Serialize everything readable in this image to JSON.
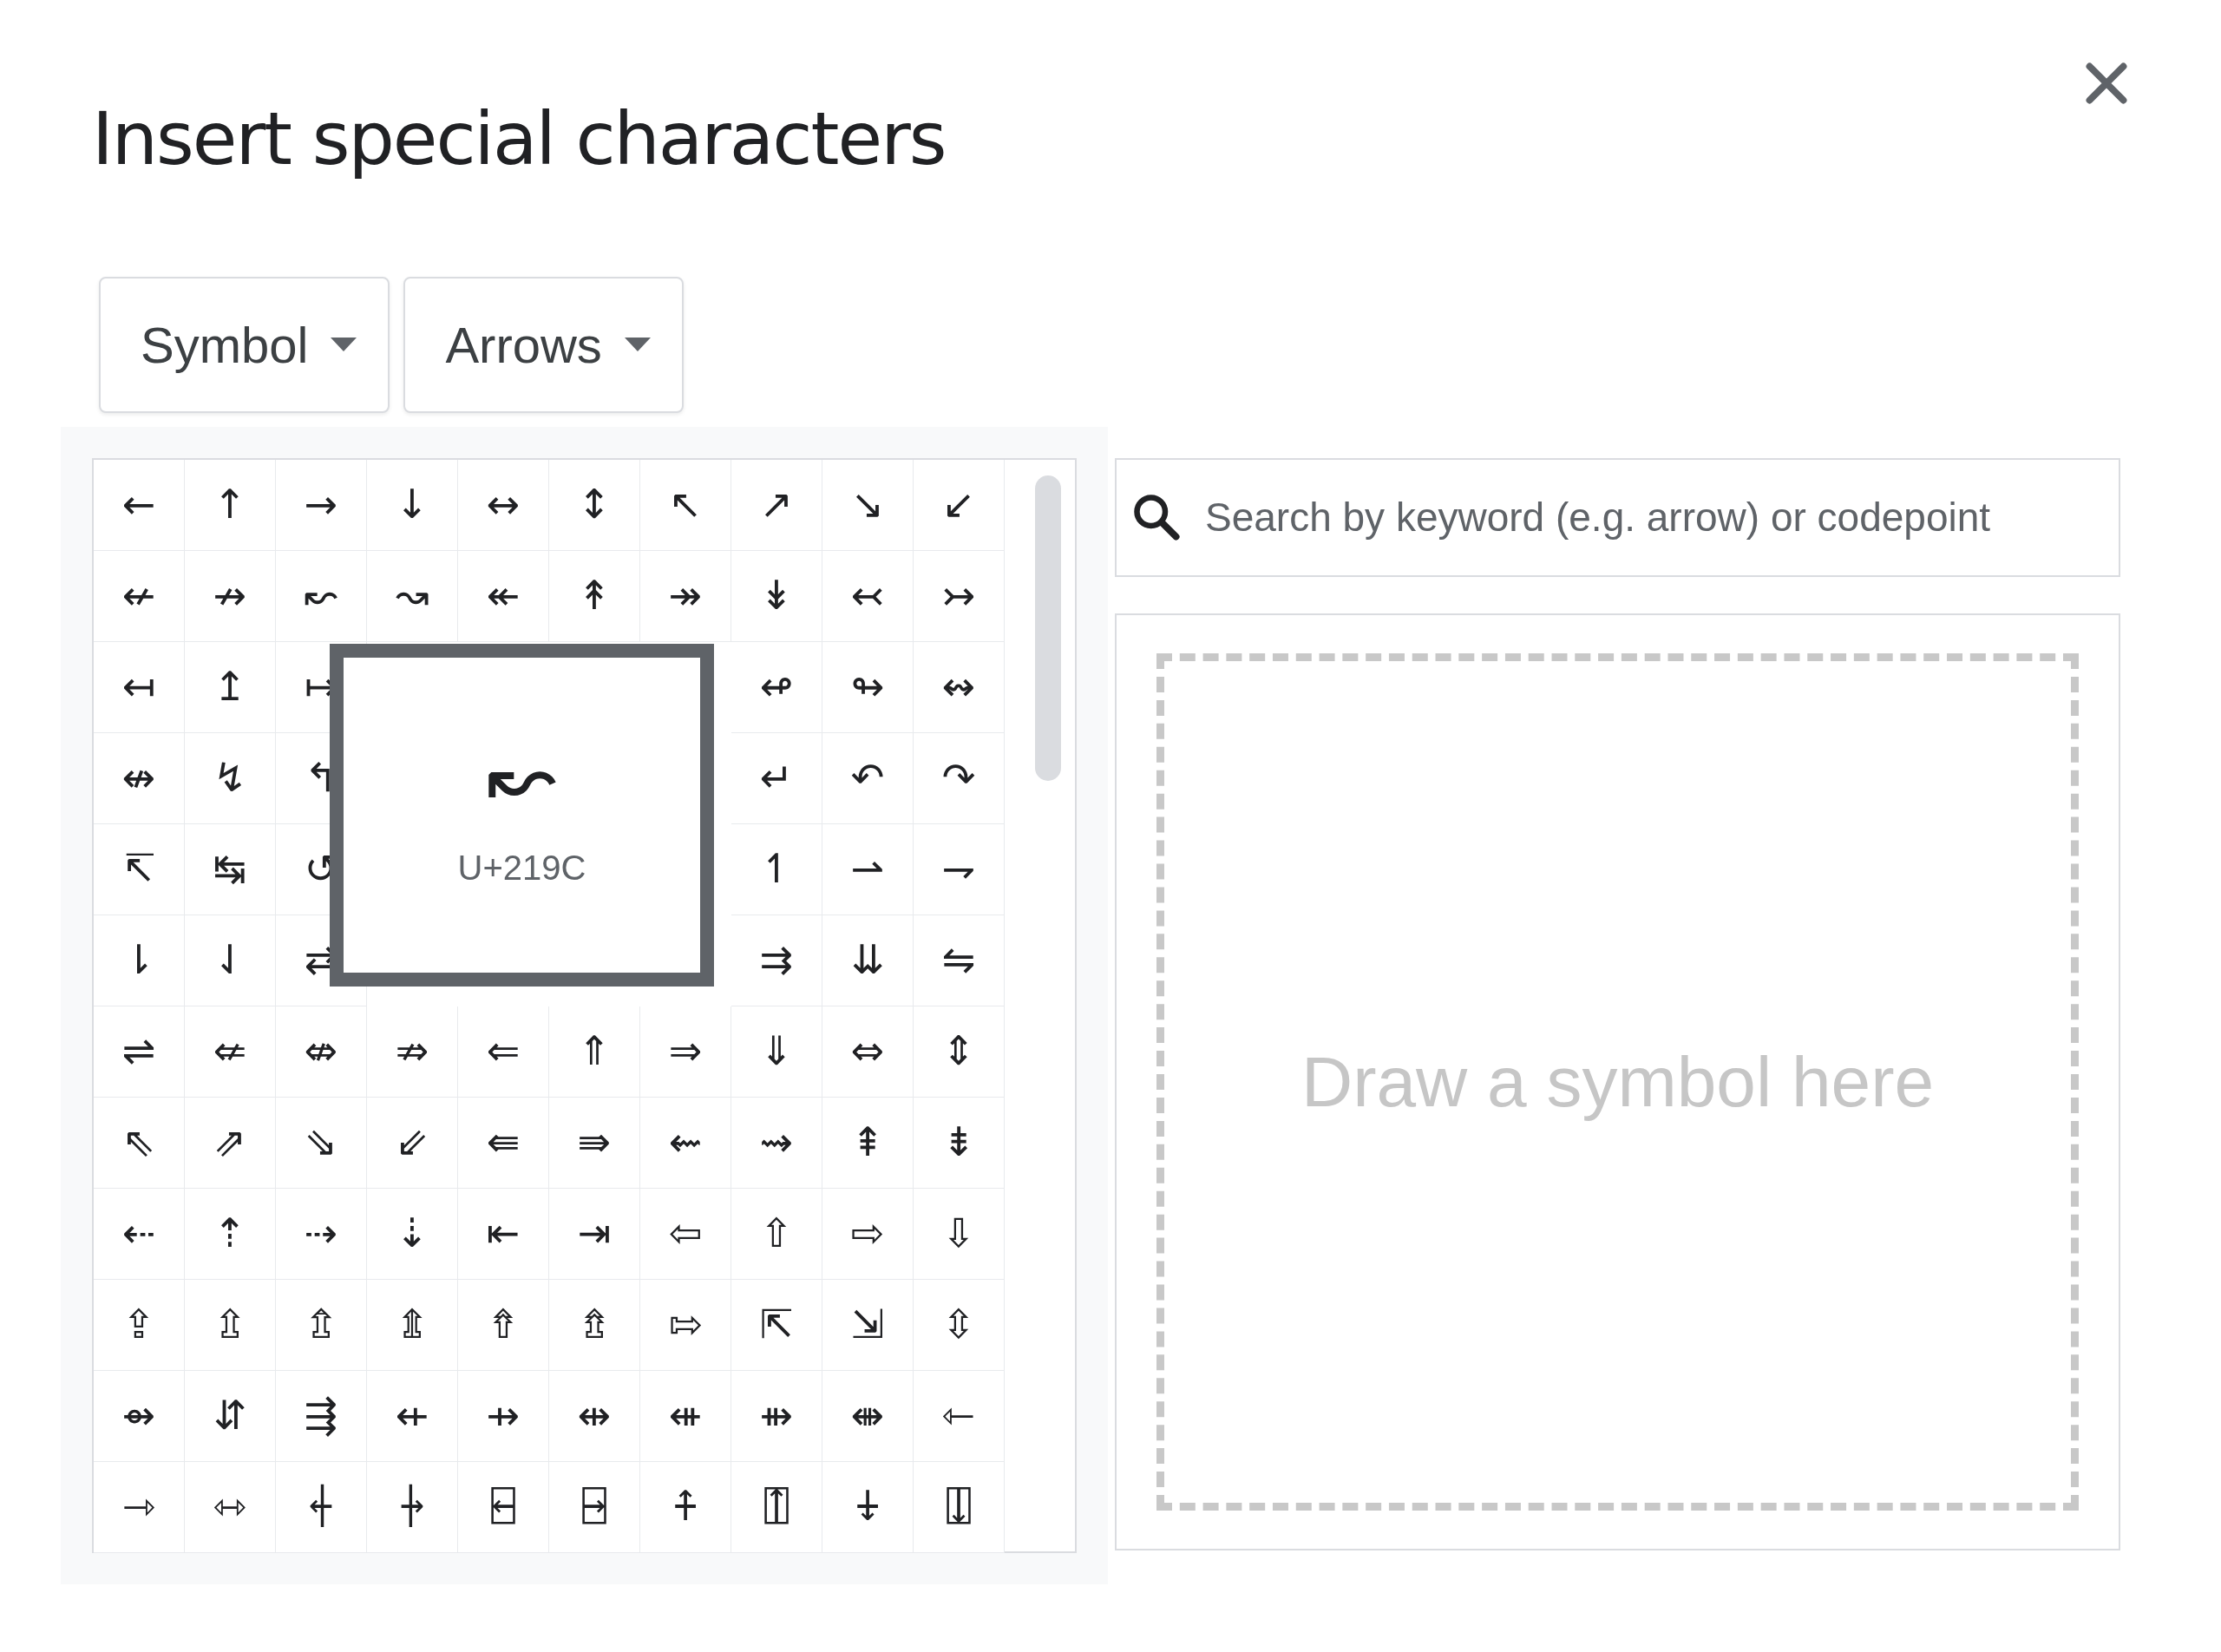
{
  "dialog": {
    "title": "Insert special characters"
  },
  "dropdowns": [
    {
      "label": "Symbol"
    },
    {
      "label": "Arrows"
    }
  ],
  "grid": {
    "rows": [
      {
        "cells": [
          "←",
          "↑",
          "→",
          "↓",
          "↔",
          "↕",
          "↖",
          "↗",
          "↘",
          "↙"
        ]
      },
      {
        "cells": [
          "↚",
          "↛",
          "↜",
          "↝",
          "↞",
          "↟",
          "↠",
          "↡",
          "↢",
          "↣"
        ]
      },
      {
        "cells": [
          "↤",
          "↥",
          "↦",
          "↫",
          "↬",
          "↭"
        ]
      },
      {
        "cells": [
          "↮",
          "↯",
          "↰",
          "↵",
          "↶",
          "↷"
        ]
      },
      {
        "cells": [
          "↸",
          "↹",
          "↺",
          "↿",
          "⇀",
          "⇁"
        ]
      },
      {
        "cells": [
          "⇂",
          "⇃",
          "⇄",
          "⇉",
          "⇊",
          "⇋"
        ]
      },
      {
        "cells": [
          "⇌",
          "⇍",
          "⇎",
          "⇏",
          "⇐",
          "⇑",
          "⇒",
          "⇓",
          "⇔",
          "⇕"
        ]
      },
      {
        "cells": [
          "⇖",
          "⇗",
          "⇘",
          "⇙",
          "⇚",
          "⇛",
          "⇜",
          "⇝",
          "⇞",
          "⇟"
        ]
      },
      {
        "cells": [
          "⇠",
          "⇡",
          "⇢",
          "⇣",
          "⇤",
          "⇥",
          "⇦",
          "⇧",
          "⇨",
          "⇩"
        ]
      },
      {
        "cells": [
          "⇪",
          "⇫",
          "⇬",
          "⇭",
          "⇮",
          "⇯",
          "⇰",
          "⇱",
          "⇲",
          "⇳"
        ]
      },
      {
        "cells": [
          "⇴",
          "⇵",
          "⇶",
          "⇷",
          "⇸",
          "⇹",
          "⇺",
          "⇻",
          "⇼",
          "⇽"
        ]
      },
      {
        "cells": [
          "⇾",
          "⇿",
          "⍅",
          "⍆",
          "⍇",
          "⍈",
          "⍏",
          "⍐",
          "⍖",
          "⍗"
        ]
      }
    ]
  },
  "preview": {
    "character": "↜",
    "codepoint": "U+219C"
  },
  "search": {
    "placeholder": "Search by keyword (e.g. arrow) or codepoint"
  },
  "drawing_area": {
    "placeholder": "Draw a symbol here"
  }
}
